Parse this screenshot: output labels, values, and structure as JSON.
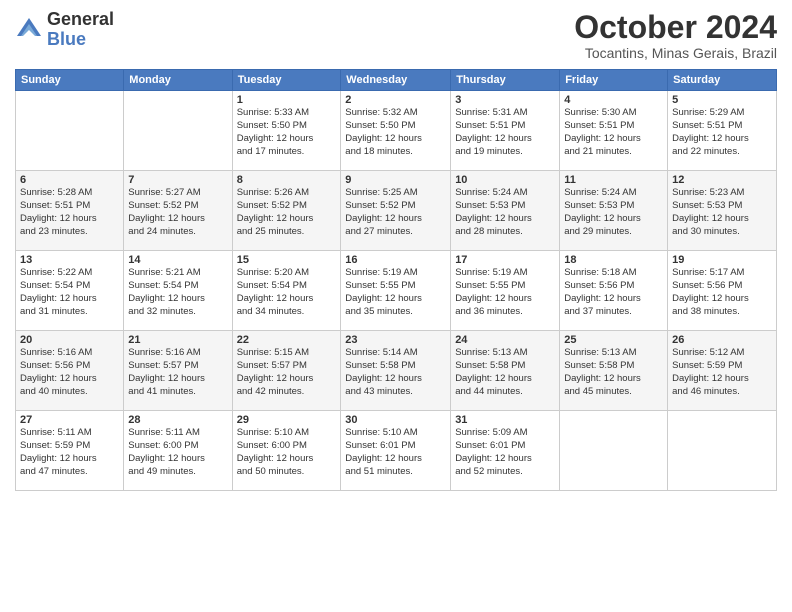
{
  "logo": {
    "general": "General",
    "blue": "Blue"
  },
  "title": "October 2024",
  "location": "Tocantins, Minas Gerais, Brazil",
  "headers": [
    "Sunday",
    "Monday",
    "Tuesday",
    "Wednesday",
    "Thursday",
    "Friday",
    "Saturday"
  ],
  "weeks": [
    [
      {
        "day": "",
        "info": ""
      },
      {
        "day": "",
        "info": ""
      },
      {
        "day": "1",
        "info": "Sunrise: 5:33 AM\nSunset: 5:50 PM\nDaylight: 12 hours\nand 17 minutes."
      },
      {
        "day": "2",
        "info": "Sunrise: 5:32 AM\nSunset: 5:50 PM\nDaylight: 12 hours\nand 18 minutes."
      },
      {
        "day": "3",
        "info": "Sunrise: 5:31 AM\nSunset: 5:51 PM\nDaylight: 12 hours\nand 19 minutes."
      },
      {
        "day": "4",
        "info": "Sunrise: 5:30 AM\nSunset: 5:51 PM\nDaylight: 12 hours\nand 21 minutes."
      },
      {
        "day": "5",
        "info": "Sunrise: 5:29 AM\nSunset: 5:51 PM\nDaylight: 12 hours\nand 22 minutes."
      }
    ],
    [
      {
        "day": "6",
        "info": "Sunrise: 5:28 AM\nSunset: 5:51 PM\nDaylight: 12 hours\nand 23 minutes."
      },
      {
        "day": "7",
        "info": "Sunrise: 5:27 AM\nSunset: 5:52 PM\nDaylight: 12 hours\nand 24 minutes."
      },
      {
        "day": "8",
        "info": "Sunrise: 5:26 AM\nSunset: 5:52 PM\nDaylight: 12 hours\nand 25 minutes."
      },
      {
        "day": "9",
        "info": "Sunrise: 5:25 AM\nSunset: 5:52 PM\nDaylight: 12 hours\nand 27 minutes."
      },
      {
        "day": "10",
        "info": "Sunrise: 5:24 AM\nSunset: 5:53 PM\nDaylight: 12 hours\nand 28 minutes."
      },
      {
        "day": "11",
        "info": "Sunrise: 5:24 AM\nSunset: 5:53 PM\nDaylight: 12 hours\nand 29 minutes."
      },
      {
        "day": "12",
        "info": "Sunrise: 5:23 AM\nSunset: 5:53 PM\nDaylight: 12 hours\nand 30 minutes."
      }
    ],
    [
      {
        "day": "13",
        "info": "Sunrise: 5:22 AM\nSunset: 5:54 PM\nDaylight: 12 hours\nand 31 minutes."
      },
      {
        "day": "14",
        "info": "Sunrise: 5:21 AM\nSunset: 5:54 PM\nDaylight: 12 hours\nand 32 minutes."
      },
      {
        "day": "15",
        "info": "Sunrise: 5:20 AM\nSunset: 5:54 PM\nDaylight: 12 hours\nand 34 minutes."
      },
      {
        "day": "16",
        "info": "Sunrise: 5:19 AM\nSunset: 5:55 PM\nDaylight: 12 hours\nand 35 minutes."
      },
      {
        "day": "17",
        "info": "Sunrise: 5:19 AM\nSunset: 5:55 PM\nDaylight: 12 hours\nand 36 minutes."
      },
      {
        "day": "18",
        "info": "Sunrise: 5:18 AM\nSunset: 5:56 PM\nDaylight: 12 hours\nand 37 minutes."
      },
      {
        "day": "19",
        "info": "Sunrise: 5:17 AM\nSunset: 5:56 PM\nDaylight: 12 hours\nand 38 minutes."
      }
    ],
    [
      {
        "day": "20",
        "info": "Sunrise: 5:16 AM\nSunset: 5:56 PM\nDaylight: 12 hours\nand 40 minutes."
      },
      {
        "day": "21",
        "info": "Sunrise: 5:16 AM\nSunset: 5:57 PM\nDaylight: 12 hours\nand 41 minutes."
      },
      {
        "day": "22",
        "info": "Sunrise: 5:15 AM\nSunset: 5:57 PM\nDaylight: 12 hours\nand 42 minutes."
      },
      {
        "day": "23",
        "info": "Sunrise: 5:14 AM\nSunset: 5:58 PM\nDaylight: 12 hours\nand 43 minutes."
      },
      {
        "day": "24",
        "info": "Sunrise: 5:13 AM\nSunset: 5:58 PM\nDaylight: 12 hours\nand 44 minutes."
      },
      {
        "day": "25",
        "info": "Sunrise: 5:13 AM\nSunset: 5:58 PM\nDaylight: 12 hours\nand 45 minutes."
      },
      {
        "day": "26",
        "info": "Sunrise: 5:12 AM\nSunset: 5:59 PM\nDaylight: 12 hours\nand 46 minutes."
      }
    ],
    [
      {
        "day": "27",
        "info": "Sunrise: 5:11 AM\nSunset: 5:59 PM\nDaylight: 12 hours\nand 47 minutes."
      },
      {
        "day": "28",
        "info": "Sunrise: 5:11 AM\nSunset: 6:00 PM\nDaylight: 12 hours\nand 49 minutes."
      },
      {
        "day": "29",
        "info": "Sunrise: 5:10 AM\nSunset: 6:00 PM\nDaylight: 12 hours\nand 50 minutes."
      },
      {
        "day": "30",
        "info": "Sunrise: 5:10 AM\nSunset: 6:01 PM\nDaylight: 12 hours\nand 51 minutes."
      },
      {
        "day": "31",
        "info": "Sunrise: 5:09 AM\nSunset: 6:01 PM\nDaylight: 12 hours\nand 52 minutes."
      },
      {
        "day": "",
        "info": ""
      },
      {
        "day": "",
        "info": ""
      }
    ]
  ]
}
